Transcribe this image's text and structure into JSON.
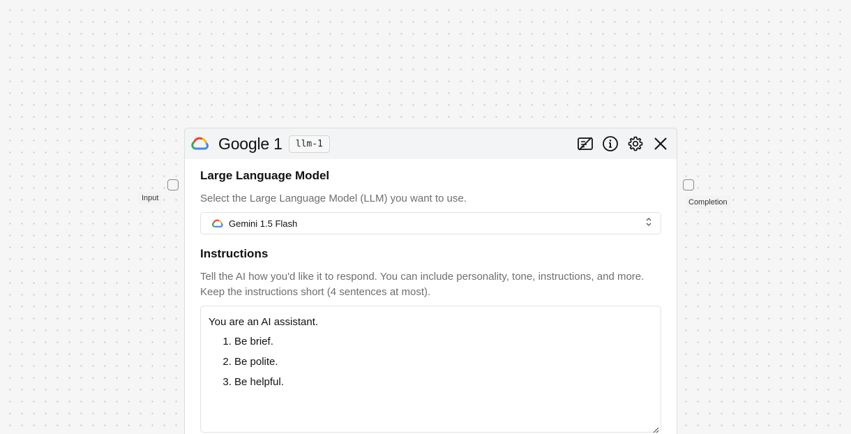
{
  "canvas": {
    "input_handle_label": "Input",
    "output_handle_label": "Completion"
  },
  "node": {
    "title": "Google 1",
    "id_badge": "llm-1",
    "logo_icon": "google-cloud-icon",
    "actions": [
      {
        "name": "hide-output-icon"
      },
      {
        "name": "info-icon"
      },
      {
        "name": "gear-icon"
      },
      {
        "name": "close-icon"
      }
    ]
  },
  "model_section": {
    "title": "Large Language Model",
    "description": "Select the Large Language Model (LLM) you want to use.",
    "selected_model": "Gemini 1.5 Flash",
    "selected_model_icon": "google-cloud-icon"
  },
  "instructions_section": {
    "title": "Instructions",
    "description": "Tell the AI how you'd like it to respond. You can include personality, tone, instructions, and more. Keep the instructions short (4 sentences at most).",
    "intro": "You are an AI assistant.",
    "items": [
      "Be brief.",
      "Be polite.",
      "Be helpful."
    ]
  },
  "colors": {
    "google_blue": "#4285F4",
    "google_red": "#EA4335",
    "google_yellow": "#FBBC05",
    "google_green": "#34A853"
  }
}
